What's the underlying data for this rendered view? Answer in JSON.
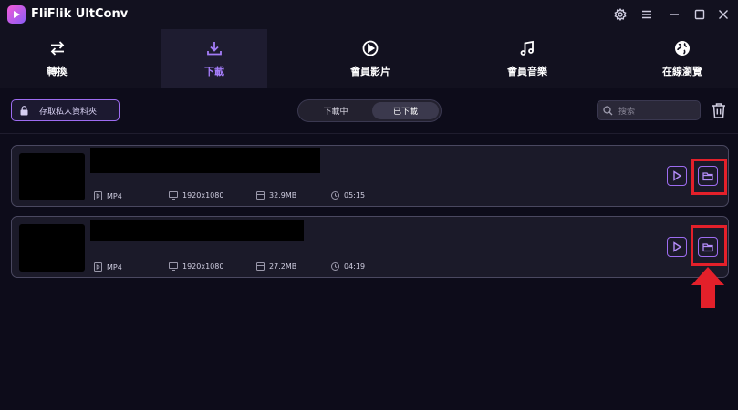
{
  "app": {
    "title": "FliFlik UltConv"
  },
  "nav": {
    "tabs": [
      {
        "label": "轉換"
      },
      {
        "label": "下載"
      },
      {
        "label": "會員影片"
      },
      {
        "label": "會員音樂"
      },
      {
        "label": "在線瀏覽"
      }
    ],
    "active_index": 1
  },
  "toolbar": {
    "private_folder_label": "存取私人資料夾",
    "segment": [
      {
        "label": "下載中"
      },
      {
        "label": "已下載"
      }
    ],
    "segment_active_index": 1,
    "search_placeholder": "搜索"
  },
  "downloads": [
    {
      "format": "MP4",
      "resolution": "1920x1080",
      "size": "32.9MB",
      "duration": "05:15"
    },
    {
      "format": "MP4",
      "resolution": "1920x1080",
      "size": "27.2MB",
      "duration": "04:19"
    }
  ],
  "colors": {
    "accent": "#9d6cf0",
    "highlight": "#e3202a",
    "background": "#0d0c1a"
  }
}
